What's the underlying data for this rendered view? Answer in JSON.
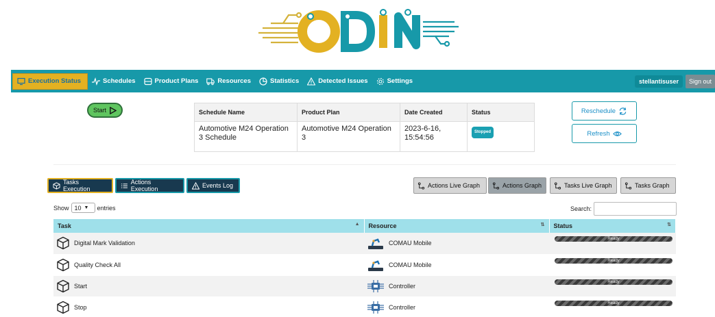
{
  "logo": {
    "text": "ODIN"
  },
  "nav": {
    "items": [
      {
        "label": "Execution Status",
        "icon": "monitor-icon"
      },
      {
        "label": "Schedules",
        "icon": "activity-icon"
      },
      {
        "label": "Product Plans",
        "icon": "database-icon"
      },
      {
        "label": "Resources",
        "icon": "truck-icon"
      },
      {
        "label": "Statistics",
        "icon": "pie-chart-icon"
      },
      {
        "label": "Detected Issues",
        "icon": "warning-icon"
      },
      {
        "label": "Settings",
        "icon": "gear-icon"
      }
    ],
    "user": "stellantisuser",
    "signout": "Sign out"
  },
  "start_button": "Start",
  "schedule": {
    "headers": [
      "Schedule Name",
      "Product Plan",
      "Date Created",
      "Status"
    ],
    "row": {
      "name": "Automotive M24 Operation 3 Schedule",
      "plan": "Automotive M24 Operation 3",
      "date": "2023-6-16, 15:54:56",
      "status": "Stopped"
    }
  },
  "actions": {
    "reschedule": "Reschedule",
    "refresh": "Refresh"
  },
  "tabs": {
    "tasks": "Tasks Execution",
    "actions": "Actions Execution",
    "events": "Events Log"
  },
  "graphs": {
    "actions_live": "Actions Live Graph",
    "actions": "Actions Graph",
    "tasks_live": "Tasks Live Graph",
    "tasks": "Tasks Graph"
  },
  "table_controls": {
    "show": "Show",
    "entries_value": "10",
    "entries": "entries",
    "search": "Search:"
  },
  "task_table": {
    "headers": [
      "Task",
      "Resource",
      "Status"
    ],
    "rows": [
      {
        "task": "Digital Mark Validation",
        "resource": "COMAU Mobile",
        "resource_type": "robot",
        "status": "Ready"
      },
      {
        "task": "Quality Check All",
        "resource": "COMAU Mobile",
        "resource_type": "robot",
        "status": "Ready"
      },
      {
        "task": "Start",
        "resource": "Controller",
        "resource_type": "controller",
        "status": "Ready"
      },
      {
        "task": "Stop",
        "resource": "Controller",
        "resource_type": "controller",
        "status": "Ready"
      }
    ]
  },
  "colors": {
    "primary": "#1799a9",
    "accent": "#e3b122",
    "dark": "#18394f",
    "start_green": "#5fc55f"
  }
}
